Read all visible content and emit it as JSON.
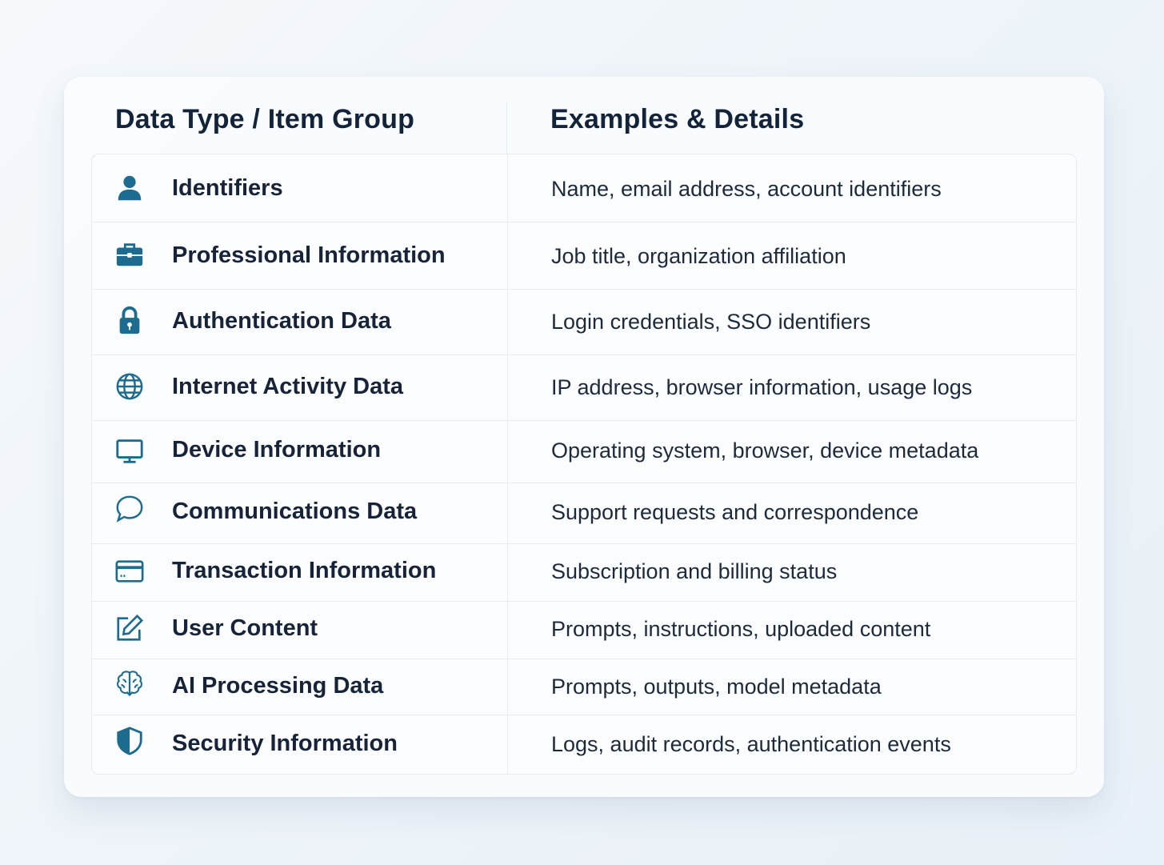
{
  "table": {
    "headers": {
      "left": "Data Type / Item Group",
      "right": "Examples & Details"
    },
    "rows": [
      {
        "icon": "person-icon",
        "label": "Identifiers",
        "detail": "Name, email address, account identifiers"
      },
      {
        "icon": "briefcase-icon",
        "label": "Professional Information",
        "detail": "Job title, organization affiliation"
      },
      {
        "icon": "lock-icon",
        "label": "Authentication Data",
        "detail": "Login credentials, SSO identifiers"
      },
      {
        "icon": "globe-icon",
        "label": "Internet Activity Data",
        "detail": "IP address, browser information, usage logs"
      },
      {
        "icon": "monitor-icon",
        "label": "Device Information",
        "detail": "Operating system, browser, device metadata"
      },
      {
        "icon": "chat-bubble-icon",
        "label": "Communications Data",
        "detail": "Support requests and correspondence"
      },
      {
        "icon": "credit-card-icon",
        "label": "Transaction Information",
        "detail": "Subscription and billing status"
      },
      {
        "icon": "edit-icon",
        "label": "User Content",
        "detail": "Prompts, instructions, uploaded content"
      },
      {
        "icon": "brain-icon",
        "label": "AI Processing Data",
        "detail": "Prompts, outputs, model metadata"
      },
      {
        "icon": "shield-icon",
        "label": "Security Information",
        "detail": "Logs, audit records, authentication events"
      }
    ]
  },
  "colors": {
    "icon": "#1d6b8f",
    "heading": "#13233a",
    "text": "#1d2a3c"
  }
}
